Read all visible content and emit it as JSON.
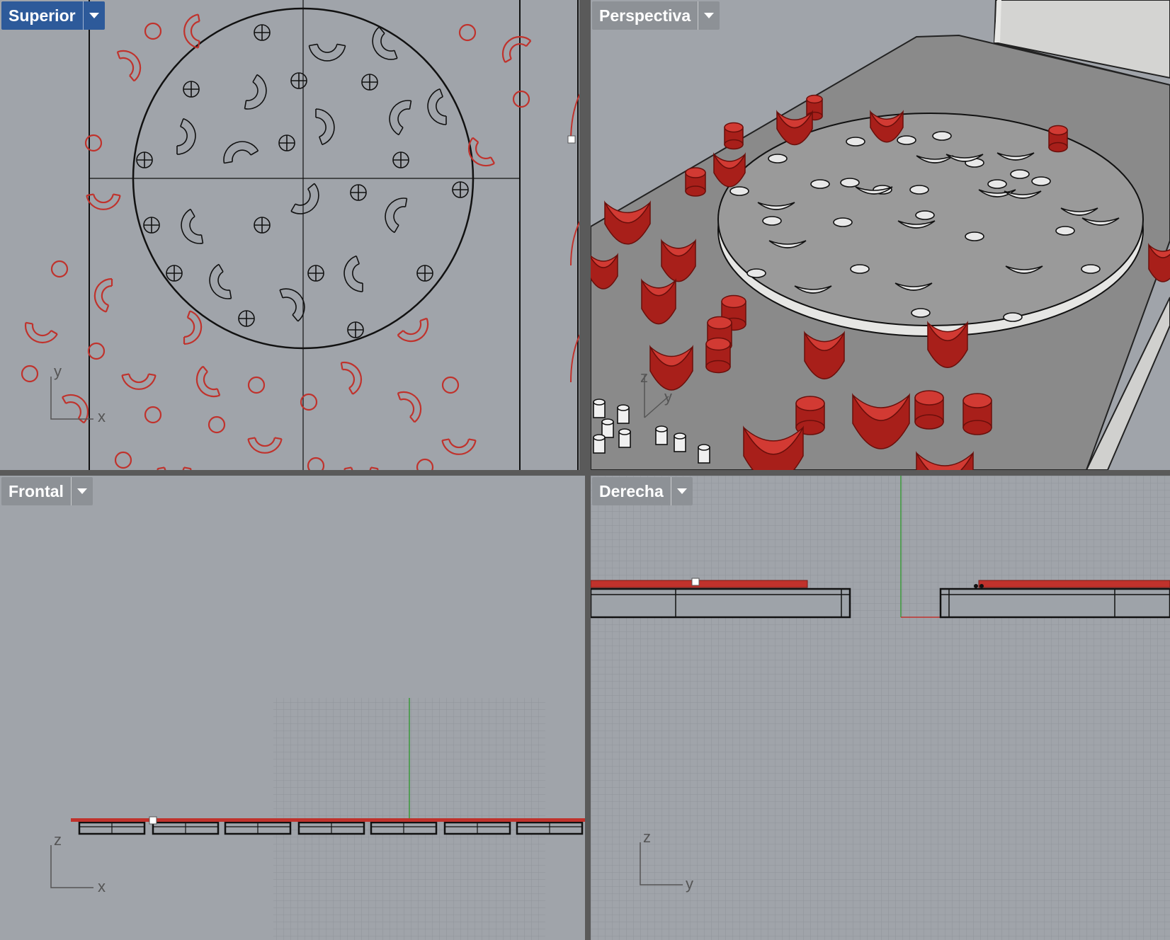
{
  "viewports": {
    "top": {
      "label": "Superior",
      "axis_a": "y",
      "axis_b": "x"
    },
    "perspective": {
      "label": "Perspectiva",
      "axis_a": "z",
      "axis_b": "y"
    },
    "front": {
      "label": "Frontal",
      "axis_a": "z",
      "axis_b": "x"
    },
    "right": {
      "label": "Derecha",
      "axis_a": "z",
      "axis_b": "y"
    }
  },
  "colors": {
    "viewport_bg": "#a0a4aa",
    "active_tab": "#2d5a9a",
    "inactive_tab": "#8d9196",
    "selected_objects": "#c0322c",
    "wireframe": "#111111"
  },
  "icons": {
    "tab_menu": "chevron-down-icon"
  }
}
